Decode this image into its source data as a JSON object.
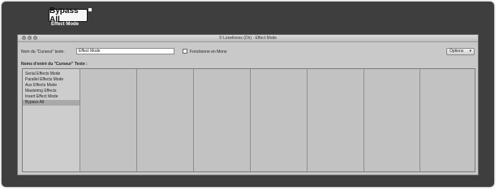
{
  "top": {
    "bypass_button": "Bypass All",
    "mode_caption": "Effect Mode"
  },
  "window": {
    "title": "© Loneliness (Dlr) - Effect Mode",
    "name_label": "Nom du \"Curseur\" texte :",
    "name_value": "Effect Mode",
    "mono_label": "Fonctionne en Mono",
    "mono_checked": false,
    "options_label": "Options",
    "list_label": "Noms d'entré du \"Curseur\" Texte :",
    "items": [
      "Serial Effects Mode",
      "Parallel Effects Mode",
      "Aux Effects Mode",
      "Mastering Effects",
      "Insert Effect Mode",
      "Bypass All"
    ],
    "selected_item": "Bypass All"
  }
}
